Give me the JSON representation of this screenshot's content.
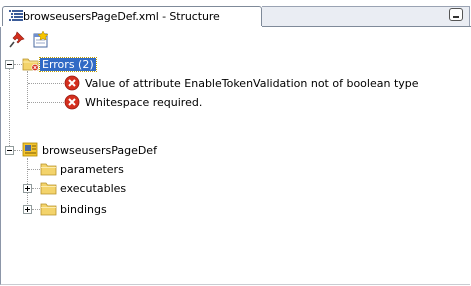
{
  "tab": {
    "title": "browseusersPageDef.xml - Structure",
    "icon": "structure-icon"
  },
  "toolbar": {
    "buttons": [
      {
        "name": "pin-icon"
      },
      {
        "name": "new-view-icon"
      }
    ]
  },
  "tree": {
    "errors_label": "Errors (2)",
    "errors": [
      "Value of attribute EnableTokenValidation not of boolean type",
      "Whitespace required."
    ],
    "root_label": "browseusersPageDef",
    "children": [
      {
        "label": "parameters",
        "expandable": false
      },
      {
        "label": "executables",
        "expandable": true
      },
      {
        "label": "bindings",
        "expandable": true
      }
    ]
  },
  "colors": {
    "selection": "#316ac5",
    "error_red": "#d42f1e",
    "folder_yellow": "#f3d36b"
  }
}
